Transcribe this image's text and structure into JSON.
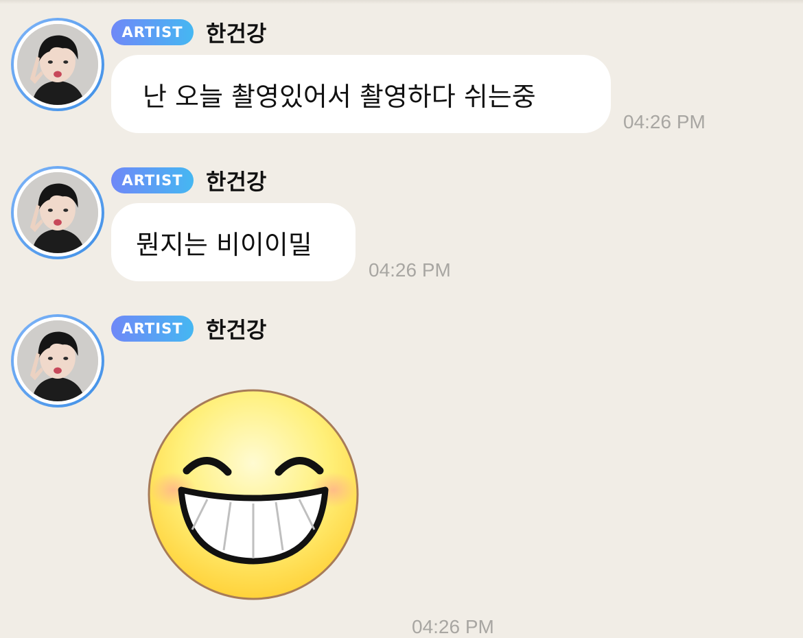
{
  "chat": {
    "messages": [
      {
        "badge": "ARTIST",
        "sender": "한건강",
        "text": "난 오늘 촬영있어서 촬영하다 쉬는중",
        "time": "04:26 PM"
      },
      {
        "badge": "ARTIST",
        "sender": "한건강",
        "text": "뭔지는 비이이밀",
        "time": "04:26 PM"
      },
      {
        "badge": "ARTIST",
        "sender": "한건강",
        "sticker": "grinning-face-sticker",
        "time": "04:26 PM"
      }
    ]
  },
  "colors": {
    "background": "#f1ede6",
    "bubble": "#ffffff",
    "badge_gradient_start": "#6f88f7",
    "badge_gradient_end": "#45b7f2",
    "avatar_ring": "#3e8fe6",
    "timestamp": "#a8a6a2"
  },
  "icons": {
    "avatar": "profile-photo",
    "sticker": "grinning-face-sticker"
  }
}
